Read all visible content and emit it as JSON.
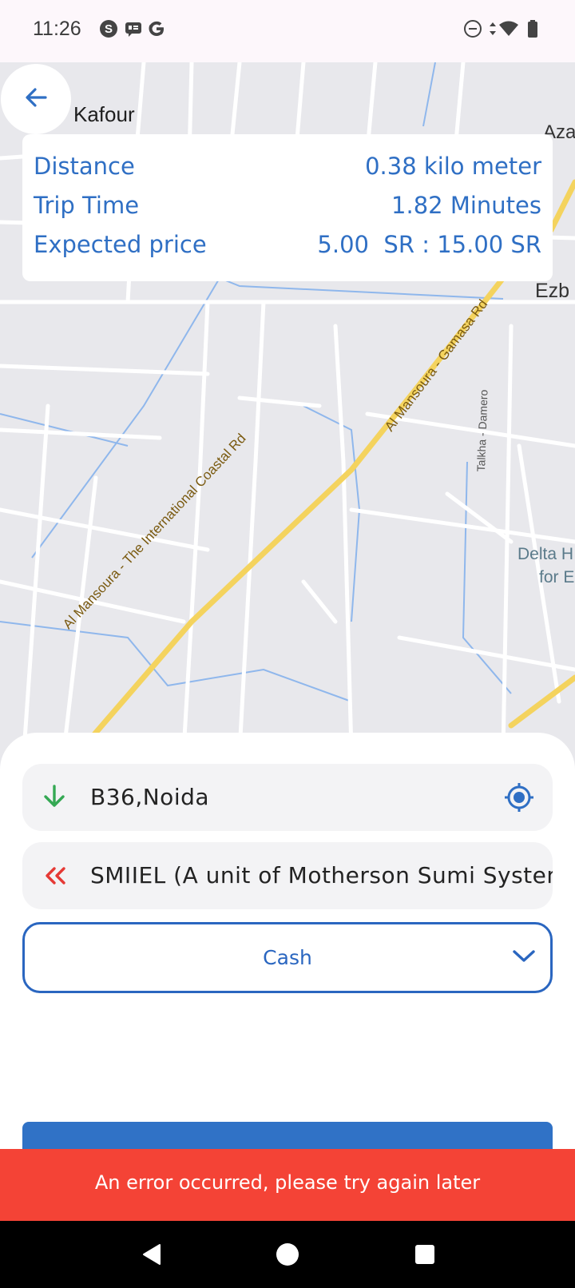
{
  "status_bar": {
    "time": "11:26",
    "left_icons": [
      "skype-icon",
      "message-icon",
      "google-icon"
    ],
    "right_icons": [
      "dnd-icon",
      "data-arrows-icon",
      "wifi-icon",
      "battery-icon"
    ]
  },
  "map": {
    "labels": {
      "kafour": "Kafour",
      "aza": "Aza",
      "ezb": "Ezb",
      "coastal_rd": "Al Mansoura - The International Coastal Rd",
      "gamasa_rd": "Al Mansoura - Gamasa Rd",
      "talkha": "Talkha - Damero",
      "delta_1": "Delta H",
      "delta_2": "for E"
    },
    "colors": {
      "background": "#e8e8ec",
      "road": "#ffffff",
      "highway": "#f4d35e",
      "water": "#8fb7ec"
    }
  },
  "trip_info": {
    "distance_label": "Distance",
    "distance_value": "0.38 kilo meter",
    "time_label": "Trip Time",
    "time_value": "1.82 Minutes",
    "price_label": "Expected price",
    "price_value": "5.00  SR : 15.00 SR"
  },
  "pickup": {
    "address": "B36,Noida"
  },
  "destination": {
    "address": "SMIIEL (A unit of Motherson Sumi Systems"
  },
  "payment": {
    "selected": "Cash"
  },
  "error": {
    "message": "An error occurred, please try again later"
  },
  "colors": {
    "accent": "#2f6fc4",
    "pickup_icon": "#34a853",
    "destination_icon": "#e53935",
    "error_bg": "#f44336"
  }
}
